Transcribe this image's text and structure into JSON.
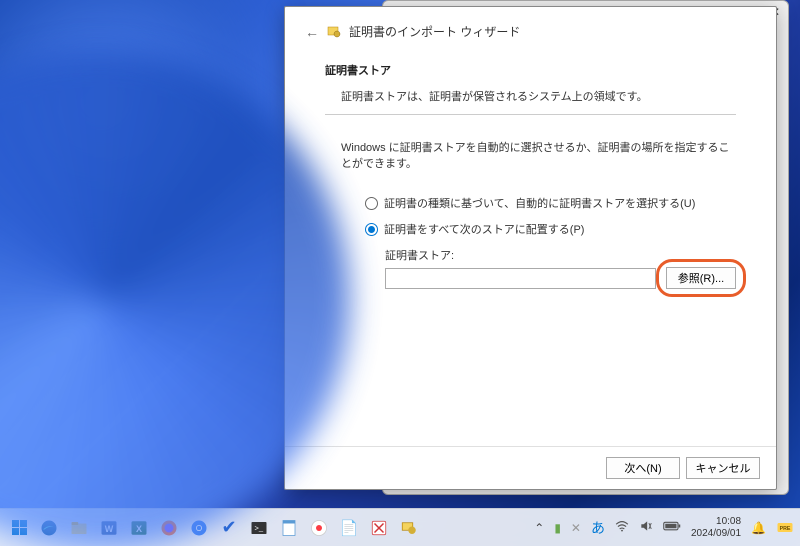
{
  "wizard": {
    "title": "証明書のインポート ウィザード",
    "section_title": "証明書ストア",
    "section_desc": "証明書ストアは、証明書が保管されるシステム上の領域です。",
    "instruction": "Windows に証明書ストアを自動的に選択させるか、証明書の場所を指定することができます。",
    "radio_auto": "証明書の種類に基づいて、自動的に証明書ストアを選択する(U)",
    "radio_manual": "証明書をすべて次のストアに配置する(P)",
    "store_label": "証明書ストア:",
    "store_value": "",
    "browse_btn": "参照(R)...",
    "next_btn": "次へ(N)",
    "cancel_btn": "キャンセル"
  },
  "taskbar": {
    "time": "10:08",
    "date": "2024/09/01"
  }
}
